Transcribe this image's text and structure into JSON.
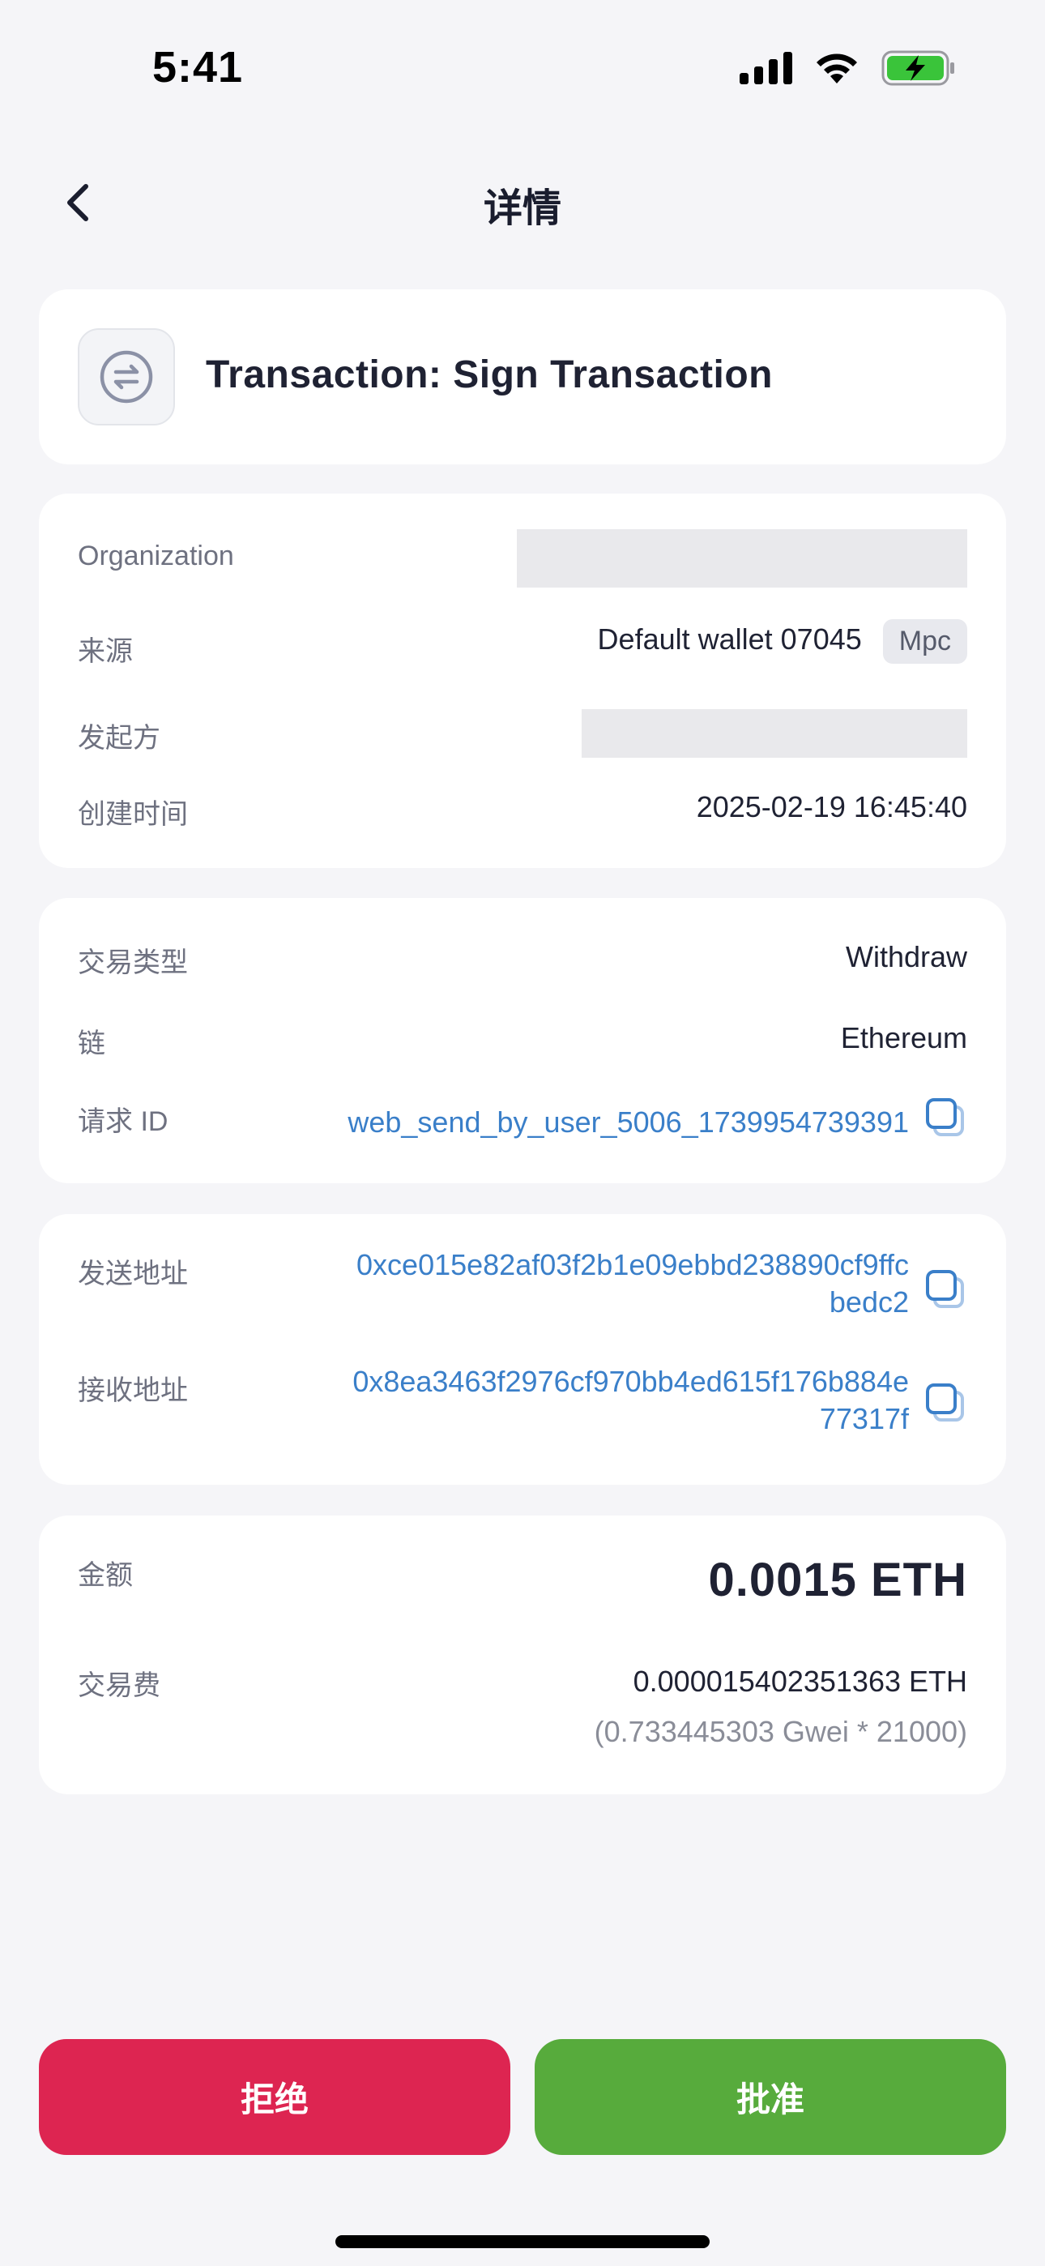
{
  "status_bar": {
    "time": "5:41",
    "icons": [
      "signal-icon",
      "wifi-icon",
      "battery-charging-icon"
    ],
    "battery_color": "#3ac43a"
  },
  "nav": {
    "back_icon": "chevron-left-icon",
    "title": "详情"
  },
  "header_card": {
    "icon": "swap-icon",
    "title": "Transaction: Sign Transaction"
  },
  "info_card": {
    "organization_label": "Organization",
    "source_label": "来源",
    "source_value": "Default wallet 07045",
    "source_badge": "Mpc",
    "initiator_label": "发起方",
    "created_label": "创建时间",
    "created_value": "2025-02-19 16:45:40"
  },
  "tx_card": {
    "type_label": "交易类型",
    "type_value": "Withdraw",
    "chain_label": "链",
    "chain_value": "Ethereum",
    "request_id_label": "请求 ID",
    "request_id_value": "web_send_by_user_5006_1739954739391"
  },
  "address_card": {
    "from_label": "发送地址",
    "from_line1": "0xce015e82af03f2b1e09ebbd238890cf9ffc",
    "from_line2": "bedc2",
    "to_label": "接收地址",
    "to_line1": "0x8ea3463f2976cf970bb4ed615f176b884e",
    "to_line2": "77317f"
  },
  "amount_card": {
    "amount_label": "金额",
    "amount_value": "0.0015 ETH",
    "fee_label": "交易费",
    "fee_value": "0.000015402351363 ETH",
    "fee_detail": "(0.733445303 Gwei * 21000)"
  },
  "actions": {
    "reject_label": "拒绝",
    "approve_label": "批准",
    "reject_color": "#dd2551",
    "approve_color": "#57ab3c"
  },
  "colors": {
    "link": "#3a7fc9",
    "background": "#f5f5f8"
  }
}
